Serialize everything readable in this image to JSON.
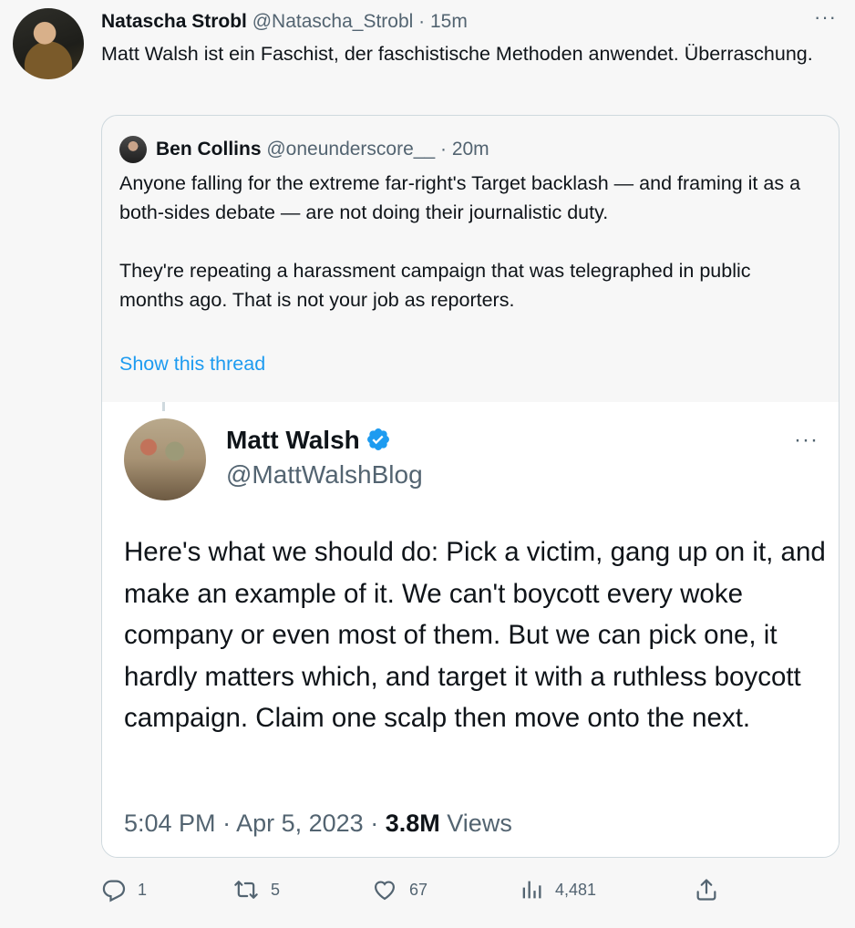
{
  "tweet": {
    "author_name": "Natascha Strobl",
    "author_handle": "@Natascha_Strobl",
    "separator": "·",
    "time": "15m",
    "text": "Matt Walsh ist ein Faschist, der faschistische Methoden anwendet. Überraschung.",
    "more": "···"
  },
  "quote": {
    "author_name": "Ben Collins",
    "author_handle": "@oneunderscore__",
    "separator": "·",
    "time": "20m",
    "paragraph1": "Anyone falling for the extreme far-right's Target backlash — and framing it as a both-sides debate — are not doing their journalistic duty.",
    "paragraph2": "They're repeating a harassment campaign that was telegraphed in public months ago. That is not your job as reporters.",
    "show_thread": "Show this thread"
  },
  "embedded": {
    "author_name": "Matt Walsh",
    "author_handle": "@MattWalshBlog",
    "more": "···",
    "text": "Here's what we should do: Pick a victim, gang up on it, and make an example of it. We can't boycott every woke company or even most of them. But we can pick one, it hardly matters which, and target it with a ruthless boycott campaign. Claim one scalp then move onto the next.",
    "time": "5:04 PM",
    "separator": "·",
    "date": "Apr 5, 2023",
    "views_count": "3.8M",
    "views_label": "Views"
  },
  "actions": {
    "replies": "1",
    "retweets": "5",
    "likes": "67",
    "views": "4,481"
  },
  "colors": {
    "link": "#1d9bf0",
    "secondary_text": "#536471",
    "verified": "#1d9bf0"
  }
}
